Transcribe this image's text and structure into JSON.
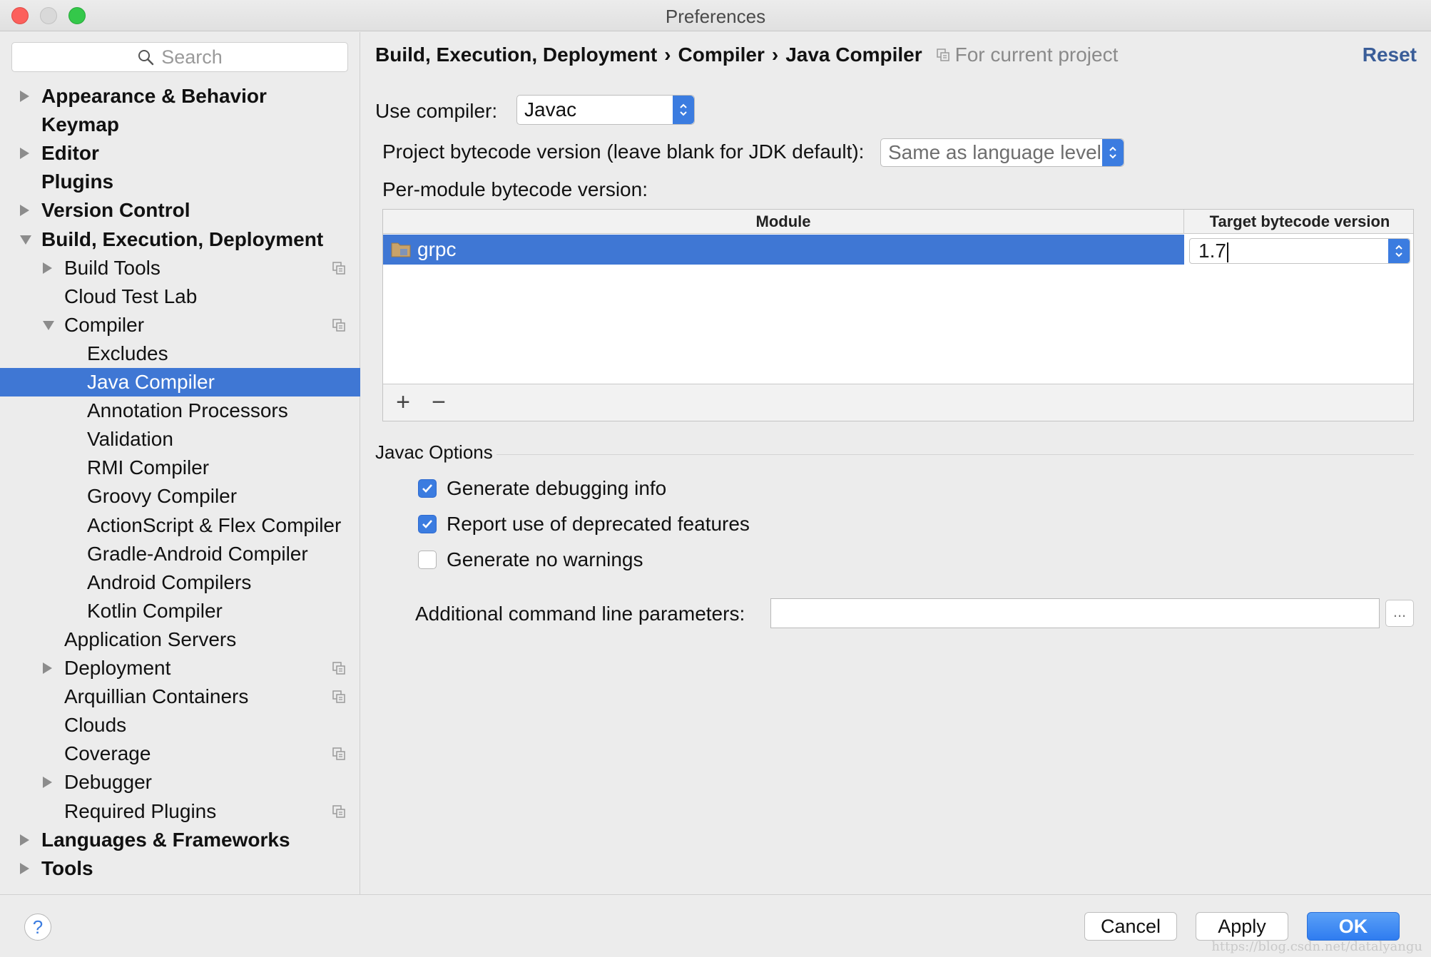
{
  "window": {
    "title": "Preferences"
  },
  "sidebar": {
    "search_placeholder": "Search",
    "items": [
      {
        "label": "Appearance & Behavior",
        "level": 0,
        "expander": "collapsed",
        "bold": true
      },
      {
        "label": "Keymap",
        "level": 0,
        "expander": "none",
        "bold": true
      },
      {
        "label": "Editor",
        "level": 0,
        "expander": "collapsed",
        "bold": true
      },
      {
        "label": "Plugins",
        "level": 0,
        "expander": "none",
        "bold": true
      },
      {
        "label": "Version Control",
        "level": 0,
        "expander": "collapsed",
        "bold": true
      },
      {
        "label": "Build, Execution, Deployment",
        "level": 0,
        "expander": "expanded",
        "bold": true
      },
      {
        "label": "Build Tools",
        "level": 1,
        "expander": "collapsed",
        "project_icon": true
      },
      {
        "label": "Cloud Test Lab",
        "level": 1,
        "expander": "none"
      },
      {
        "label": "Compiler",
        "level": 1,
        "expander": "expanded",
        "project_icon": true
      },
      {
        "label": "Excludes",
        "level": 2,
        "expander": "none"
      },
      {
        "label": "Java Compiler",
        "level": 2,
        "expander": "none",
        "selected": true
      },
      {
        "label": "Annotation Processors",
        "level": 2,
        "expander": "none"
      },
      {
        "label": "Validation",
        "level": 2,
        "expander": "none"
      },
      {
        "label": "RMI Compiler",
        "level": 2,
        "expander": "none"
      },
      {
        "label": "Groovy Compiler",
        "level": 2,
        "expander": "none"
      },
      {
        "label": "ActionScript & Flex Compiler",
        "level": 2,
        "expander": "none"
      },
      {
        "label": "Gradle-Android Compiler",
        "level": 2,
        "expander": "none"
      },
      {
        "label": "Android Compilers",
        "level": 2,
        "expander": "none"
      },
      {
        "label": "Kotlin Compiler",
        "level": 2,
        "expander": "none"
      },
      {
        "label": "Application Servers",
        "level": 1,
        "expander": "none"
      },
      {
        "label": "Deployment",
        "level": 1,
        "expander": "collapsed",
        "project_icon": true
      },
      {
        "label": "Arquillian Containers",
        "level": 1,
        "expander": "none",
        "project_icon": true
      },
      {
        "label": "Clouds",
        "level": 1,
        "expander": "none"
      },
      {
        "label": "Coverage",
        "level": 1,
        "expander": "none",
        "project_icon": true
      },
      {
        "label": "Debugger",
        "level": 1,
        "expander": "collapsed"
      },
      {
        "label": "Required Plugins",
        "level": 1,
        "expander": "none",
        "project_icon": true
      },
      {
        "label": "Languages & Frameworks",
        "level": 0,
        "expander": "collapsed",
        "bold": true
      },
      {
        "label": "Tools",
        "level": 0,
        "expander": "collapsed",
        "bold": true
      }
    ]
  },
  "header": {
    "breadcrumb": [
      "Build, Execution, Deployment",
      "Compiler",
      "Java Compiler"
    ],
    "separator": "›",
    "scope": "For current project",
    "reset": "Reset"
  },
  "compiler": {
    "use_compiler_label": "Use compiler:",
    "use_compiler_value": "Javac",
    "bytecode_label": "Project bytecode version (leave blank for JDK default):",
    "bytecode_value": "Same as language level",
    "per_module_label": "Per-module bytecode version:"
  },
  "module_table": {
    "columns": [
      "Module",
      "Target bytecode version"
    ],
    "rows": [
      {
        "module": "grpc",
        "target": "1.7"
      }
    ],
    "add": "+",
    "remove": "−"
  },
  "javac_options": {
    "title": "Javac Options",
    "checkboxes": [
      {
        "label": "Generate debugging info",
        "checked": true
      },
      {
        "label": "Report use of deprecated features",
        "checked": true
      },
      {
        "label": "Generate no warnings",
        "checked": false
      }
    ],
    "cmd_label": "Additional command line parameters:",
    "cmd_value": "",
    "ellipsis": "..."
  },
  "footer": {
    "help": "?",
    "cancel": "Cancel",
    "apply": "Apply",
    "ok": "OK",
    "watermark": "https://blog.csdn.net/datalyangu"
  },
  "colors": {
    "selection": "#3f77d4",
    "accent": "#3b7ce0",
    "link": "#3a5d98"
  }
}
